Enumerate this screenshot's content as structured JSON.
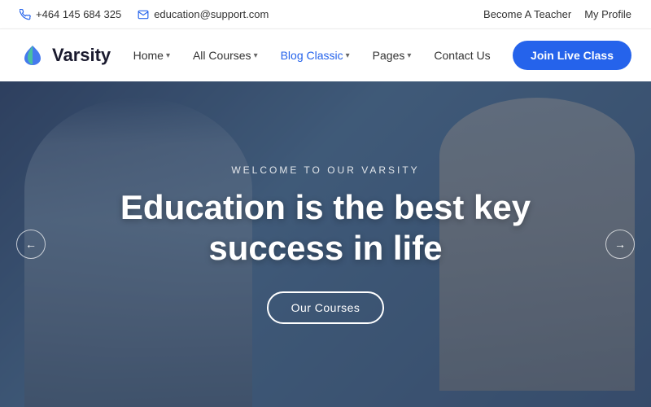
{
  "topbar": {
    "phone": "+464 145 684 325",
    "email": "education@support.com",
    "become_teacher": "Become A Teacher",
    "my_profile": "My Profile"
  },
  "navbar": {
    "logo_text": "Varsity",
    "nav_items": [
      {
        "label": "Home",
        "has_dropdown": true,
        "active": false
      },
      {
        "label": "All Courses",
        "has_dropdown": true,
        "active": false
      },
      {
        "label": "Blog Classic",
        "has_dropdown": true,
        "active": true
      },
      {
        "label": "Pages",
        "has_dropdown": true,
        "active": false
      },
      {
        "label": "Contact Us",
        "has_dropdown": false,
        "active": false
      }
    ],
    "cta_label": "Join Live Class"
  },
  "hero": {
    "subtitle": "WELCOME TO OUR VARSITY",
    "title_line1": "Education is the best key",
    "title_line2": "success in life",
    "cta_label": "Our Courses",
    "arrow_left": "←",
    "arrow_right": "→"
  }
}
